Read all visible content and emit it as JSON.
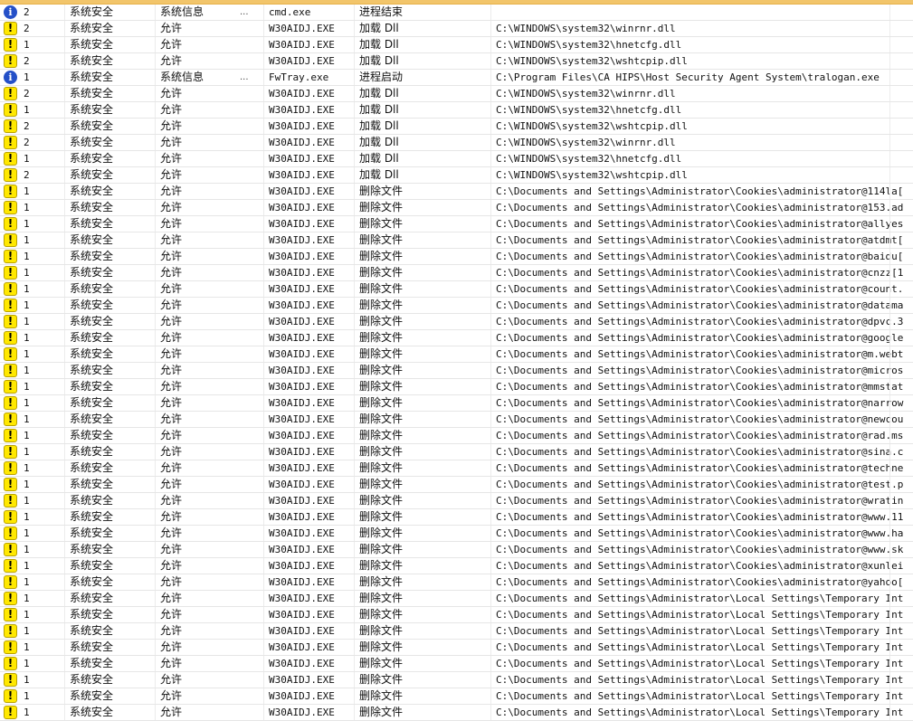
{
  "log": {
    "rows": [
      {
        "type": "info",
        "level": "2",
        "category": "系统安全",
        "action": "系统信息",
        "action_suffix": "...",
        "process": "cmd.exe",
        "operation": "进程结束",
        "path": ""
      },
      {
        "type": "warn",
        "level": "2",
        "category": "系统安全",
        "action": "允许",
        "action_suffix": "",
        "process": "W30AIDJ.EXE",
        "operation": "加载 Dll",
        "path": "C:\\WINDOWS\\system32\\winrnr.dll"
      },
      {
        "type": "warn",
        "level": "1",
        "category": "系统安全",
        "action": "允许",
        "action_suffix": "",
        "process": "W30AIDJ.EXE",
        "operation": "加载 Dll",
        "path": "C:\\WINDOWS\\system32\\hnetcfg.dll"
      },
      {
        "type": "warn",
        "level": "2",
        "category": "系统安全",
        "action": "允许",
        "action_suffix": "",
        "process": "W30AIDJ.EXE",
        "operation": "加载 Dll",
        "path": "C:\\WINDOWS\\system32\\wshtcpip.dll"
      },
      {
        "type": "info",
        "level": "1",
        "category": "系统安全",
        "action": "系统信息",
        "action_suffix": "...",
        "process": "FwTray.exe",
        "operation": "进程启动",
        "path": "C:\\Program Files\\CA HIPS\\Host Security Agent System\\tralogan.exe"
      },
      {
        "type": "warn",
        "level": "2",
        "category": "系统安全",
        "action": "允许",
        "action_suffix": "",
        "process": "W30AIDJ.EXE",
        "operation": "加载 Dll",
        "path": "C:\\WINDOWS\\system32\\winrnr.dll"
      },
      {
        "type": "warn",
        "level": "1",
        "category": "系统安全",
        "action": "允许",
        "action_suffix": "",
        "process": "W30AIDJ.EXE",
        "operation": "加载 Dll",
        "path": "C:\\WINDOWS\\system32\\hnetcfg.dll"
      },
      {
        "type": "warn",
        "level": "2",
        "category": "系统安全",
        "action": "允许",
        "action_suffix": "",
        "process": "W30AIDJ.EXE",
        "operation": "加载 Dll",
        "path": "C:\\WINDOWS\\system32\\wshtcpip.dll"
      },
      {
        "type": "warn",
        "level": "2",
        "category": "系统安全",
        "action": "允许",
        "action_suffix": "",
        "process": "W30AIDJ.EXE",
        "operation": "加载 Dll",
        "path": "C:\\WINDOWS\\system32\\winrnr.dll"
      },
      {
        "type": "warn",
        "level": "1",
        "category": "系统安全",
        "action": "允许",
        "action_suffix": "",
        "process": "W30AIDJ.EXE",
        "operation": "加载 Dll",
        "path": "C:\\WINDOWS\\system32\\hnetcfg.dll"
      },
      {
        "type": "warn",
        "level": "2",
        "category": "系统安全",
        "action": "允许",
        "action_suffix": "",
        "process": "W30AIDJ.EXE",
        "operation": "加载 Dll",
        "path": "C:\\WINDOWS\\system32\\wshtcpip.dll"
      },
      {
        "type": "warn",
        "level": "1",
        "category": "系统安全",
        "action": "允许",
        "action_suffix": "",
        "process": "W30AIDJ.EXE",
        "operation": "删除文件",
        "path": "C:\\Documents and Settings\\Administrator\\Cookies\\administrator@114la[..."
      },
      {
        "type": "warn",
        "level": "1",
        "category": "系统安全",
        "action": "允许",
        "action_suffix": "",
        "process": "W30AIDJ.EXE",
        "operation": "删除文件",
        "path": "C:\\Documents and Settings\\Administrator\\Cookies\\administrator@153.ad..."
      },
      {
        "type": "warn",
        "level": "1",
        "category": "系统安全",
        "action": "允许",
        "action_suffix": "",
        "process": "W30AIDJ.EXE",
        "operation": "删除文件",
        "path": "C:\\Documents and Settings\\Administrator\\Cookies\\administrator@allyes..."
      },
      {
        "type": "warn",
        "level": "1",
        "category": "系统安全",
        "action": "允许",
        "action_suffix": "",
        "process": "W30AIDJ.EXE",
        "operation": "删除文件",
        "path": "C:\\Documents and Settings\\Administrator\\Cookies\\administrator@atdmt[..."
      },
      {
        "type": "warn",
        "level": "1",
        "category": "系统安全",
        "action": "允许",
        "action_suffix": "",
        "process": "W30AIDJ.EXE",
        "operation": "删除文件",
        "path": "C:\\Documents and Settings\\Administrator\\Cookies\\administrator@baidu[..."
      },
      {
        "type": "warn",
        "level": "1",
        "category": "系统安全",
        "action": "允许",
        "action_suffix": "",
        "process": "W30AIDJ.EXE",
        "operation": "删除文件",
        "path": "C:\\Documents and Settings\\Administrator\\Cookies\\administrator@cnzz[1..."
      },
      {
        "type": "warn",
        "level": "1",
        "category": "系统安全",
        "action": "允许",
        "action_suffix": "",
        "process": "W30AIDJ.EXE",
        "operation": "删除文件",
        "path": "C:\\Documents and Settings\\Administrator\\Cookies\\administrator@count...."
      },
      {
        "type": "warn",
        "level": "1",
        "category": "系统安全",
        "action": "允许",
        "action_suffix": "",
        "process": "W30AIDJ.EXE",
        "operation": "删除文件",
        "path": "C:\\Documents and Settings\\Administrator\\Cookies\\administrator@datama..."
      },
      {
        "type": "warn",
        "level": "1",
        "category": "系统安全",
        "action": "允许",
        "action_suffix": "",
        "process": "W30AIDJ.EXE",
        "operation": "删除文件",
        "path": "C:\\Documents and Settings\\Administrator\\Cookies\\administrator@dpvc.3..."
      },
      {
        "type": "warn",
        "level": "1",
        "category": "系统安全",
        "action": "允许",
        "action_suffix": "",
        "process": "W30AIDJ.EXE",
        "operation": "删除文件",
        "path": "C:\\Documents and Settings\\Administrator\\Cookies\\administrator@google..."
      },
      {
        "type": "warn",
        "level": "1",
        "category": "系统安全",
        "action": "允许",
        "action_suffix": "",
        "process": "W30AIDJ.EXE",
        "operation": "删除文件",
        "path": "C:\\Documents and Settings\\Administrator\\Cookies\\administrator@m.webt..."
      },
      {
        "type": "warn",
        "level": "1",
        "category": "系统安全",
        "action": "允许",
        "action_suffix": "",
        "process": "W30AIDJ.EXE",
        "operation": "删除文件",
        "path": "C:\\Documents and Settings\\Administrator\\Cookies\\administrator@micros..."
      },
      {
        "type": "warn",
        "level": "1",
        "category": "系统安全",
        "action": "允许",
        "action_suffix": "",
        "process": "W30AIDJ.EXE",
        "operation": "删除文件",
        "path": "C:\\Documents and Settings\\Administrator\\Cookies\\administrator@mmstat..."
      },
      {
        "type": "warn",
        "level": "1",
        "category": "系统安全",
        "action": "允许",
        "action_suffix": "",
        "process": "W30AIDJ.EXE",
        "operation": "删除文件",
        "path": "C:\\Documents and Settings\\Administrator\\Cookies\\administrator@narrow..."
      },
      {
        "type": "warn",
        "level": "1",
        "category": "系统安全",
        "action": "允许",
        "action_suffix": "",
        "process": "W30AIDJ.EXE",
        "operation": "删除文件",
        "path": "C:\\Documents and Settings\\Administrator\\Cookies\\administrator@newcou..."
      },
      {
        "type": "warn",
        "level": "1",
        "category": "系统安全",
        "action": "允许",
        "action_suffix": "",
        "process": "W30AIDJ.EXE",
        "operation": "删除文件",
        "path": "C:\\Documents and Settings\\Administrator\\Cookies\\administrator@rad.ms..."
      },
      {
        "type": "warn",
        "level": "1",
        "category": "系统安全",
        "action": "允许",
        "action_suffix": "",
        "process": "W30AIDJ.EXE",
        "operation": "删除文件",
        "path": "C:\\Documents and Settings\\Administrator\\Cookies\\administrator@sina.c..."
      },
      {
        "type": "warn",
        "level": "1",
        "category": "系统安全",
        "action": "允许",
        "action_suffix": "",
        "process": "W30AIDJ.EXE",
        "operation": "删除文件",
        "path": "C:\\Documents and Settings\\Administrator\\Cookies\\administrator@techne..."
      },
      {
        "type": "warn",
        "level": "1",
        "category": "系统安全",
        "action": "允许",
        "action_suffix": "",
        "process": "W30AIDJ.EXE",
        "operation": "删除文件",
        "path": "C:\\Documents and Settings\\Administrator\\Cookies\\administrator@test.p..."
      },
      {
        "type": "warn",
        "level": "1",
        "category": "系统安全",
        "action": "允许",
        "action_suffix": "",
        "process": "W30AIDJ.EXE",
        "operation": "删除文件",
        "path": "C:\\Documents and Settings\\Administrator\\Cookies\\administrator@wratin..."
      },
      {
        "type": "warn",
        "level": "1",
        "category": "系统安全",
        "action": "允许",
        "action_suffix": "",
        "process": "W30AIDJ.EXE",
        "operation": "删除文件",
        "path": "C:\\Documents and Settings\\Administrator\\Cookies\\administrator@www.11..."
      },
      {
        "type": "warn",
        "level": "1",
        "category": "系统安全",
        "action": "允许",
        "action_suffix": "",
        "process": "W30AIDJ.EXE",
        "operation": "删除文件",
        "path": "C:\\Documents and Settings\\Administrator\\Cookies\\administrator@www.ha..."
      },
      {
        "type": "warn",
        "level": "1",
        "category": "系统安全",
        "action": "允许",
        "action_suffix": "",
        "process": "W30AIDJ.EXE",
        "operation": "删除文件",
        "path": "C:\\Documents and Settings\\Administrator\\Cookies\\administrator@www.sk..."
      },
      {
        "type": "warn",
        "level": "1",
        "category": "系统安全",
        "action": "允许",
        "action_suffix": "",
        "process": "W30AIDJ.EXE",
        "operation": "删除文件",
        "path": "C:\\Documents and Settings\\Administrator\\Cookies\\administrator@xunlei..."
      },
      {
        "type": "warn",
        "level": "1",
        "category": "系统安全",
        "action": "允许",
        "action_suffix": "",
        "process": "W30AIDJ.EXE",
        "operation": "删除文件",
        "path": "C:\\Documents and Settings\\Administrator\\Cookies\\administrator@yahoo[..."
      },
      {
        "type": "warn",
        "level": "1",
        "category": "系统安全",
        "action": "允许",
        "action_suffix": "",
        "process": "W30AIDJ.EXE",
        "operation": "删除文件",
        "path": "C:\\Documents and Settings\\Administrator\\Local Settings\\Temporary Int..."
      },
      {
        "type": "warn",
        "level": "1",
        "category": "系统安全",
        "action": "允许",
        "action_suffix": "",
        "process": "W30AIDJ.EXE",
        "operation": "删除文件",
        "path": "C:\\Documents and Settings\\Administrator\\Local Settings\\Temporary Int..."
      },
      {
        "type": "warn",
        "level": "1",
        "category": "系统安全",
        "action": "允许",
        "action_suffix": "",
        "process": "W30AIDJ.EXE",
        "operation": "删除文件",
        "path": "C:\\Documents and Settings\\Administrator\\Local Settings\\Temporary Int..."
      },
      {
        "type": "warn",
        "level": "1",
        "category": "系统安全",
        "action": "允许",
        "action_suffix": "",
        "process": "W30AIDJ.EXE",
        "operation": "删除文件",
        "path": "C:\\Documents and Settings\\Administrator\\Local Settings\\Temporary Int..."
      },
      {
        "type": "warn",
        "level": "1",
        "category": "系统安全",
        "action": "允许",
        "action_suffix": "",
        "process": "W30AIDJ.EXE",
        "operation": "删除文件",
        "path": "C:\\Documents and Settings\\Administrator\\Local Settings\\Temporary Int..."
      },
      {
        "type": "warn",
        "level": "1",
        "category": "系统安全",
        "action": "允许",
        "action_suffix": "",
        "process": "W30AIDJ.EXE",
        "operation": "删除文件",
        "path": "C:\\Documents and Settings\\Administrator\\Local Settings\\Temporary Int..."
      },
      {
        "type": "warn",
        "level": "1",
        "category": "系统安全",
        "action": "允许",
        "action_suffix": "",
        "process": "W30AIDJ.EXE",
        "operation": "删除文件",
        "path": "C:\\Documents and Settings\\Administrator\\Local Settings\\Temporary Int..."
      },
      {
        "type": "warn",
        "level": "1",
        "category": "系统安全",
        "action": "允许",
        "action_suffix": "",
        "process": "W30AIDJ.EXE",
        "operation": "删除文件",
        "path": "C:\\Documents and Settings\\Administrator\\Local Settings\\Temporary Int..."
      }
    ]
  },
  "icons": {
    "info": "info-icon",
    "warn": "warning-icon"
  },
  "colors": {
    "header_accent": "#f2c56b",
    "info_blue": "#2450c8",
    "warn_yellow": "#ffe800",
    "grid_line": "#e6e6e6"
  }
}
